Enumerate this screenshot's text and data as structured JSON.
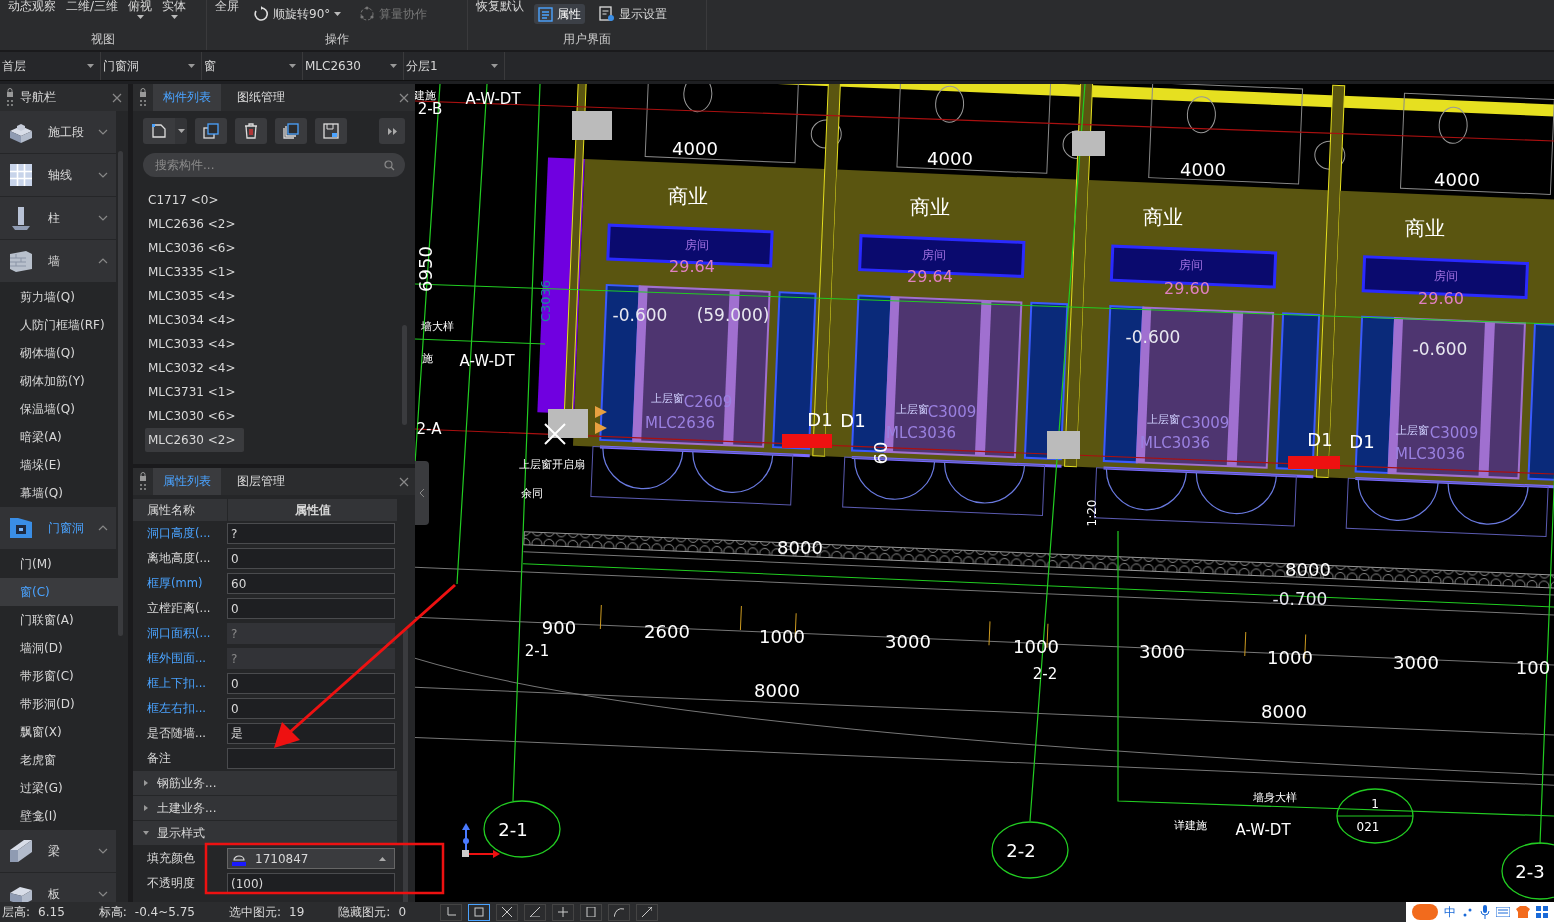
{
  "ribbon": {
    "groups": [
      {
        "label": "视图",
        "buttons": [
          {
            "label": "动态观察",
            "kind": "text",
            "dropdown": false,
            "selected": false,
            "disabled": false
          },
          {
            "label": "二维/三维",
            "kind": "text",
            "dropdown": false,
            "selected": false,
            "disabled": false
          },
          {
            "label": "俯视",
            "kind": "text",
            "dropdown": true,
            "selected": false,
            "disabled": false
          },
          {
            "label": "实体",
            "kind": "text",
            "dropdown": true,
            "selected": false,
            "disabled": false
          }
        ]
      },
      {
        "label": "操作",
        "buttons": [
          {
            "label": "全屏",
            "kind": "text",
            "dropdown": false,
            "selected": false,
            "disabled": false
          },
          {
            "label": "顺旋转90°",
            "kind": "rotate",
            "dropdown": true,
            "selected": false,
            "disabled": false
          },
          {
            "label": "算量协作",
            "kind": "collab",
            "dropdown": false,
            "selected": false,
            "disabled": true
          }
        ]
      },
      {
        "label": "用户界面",
        "buttons": [
          {
            "label": "恢复默认",
            "kind": "text",
            "dropdown": false,
            "selected": false,
            "disabled": false
          },
          {
            "label": "属性",
            "kind": "panel",
            "dropdown": false,
            "selected": true,
            "disabled": false
          },
          {
            "label": "显示设置",
            "kind": "settings",
            "dropdown": false,
            "selected": false,
            "disabled": false
          }
        ]
      }
    ]
  },
  "selectors": [
    "首层",
    "门窗洞",
    "窗",
    "MLC2630",
    "分层1"
  ],
  "nav": {
    "title": "导航栏",
    "groups": [
      {
        "label": "施工段",
        "expanded": false,
        "active": false
      },
      {
        "label": "轴线",
        "expanded": false,
        "active": false
      },
      {
        "label": "柱",
        "expanded": false,
        "active": false
      },
      {
        "label": "墙",
        "expanded": true,
        "active": false,
        "children": [
          {
            "label": "剪力墙(Q)",
            "selected": false
          },
          {
            "label": "人防门框墙(RF)",
            "selected": false
          },
          {
            "label": "砌体墙(Q)",
            "selected": false
          },
          {
            "label": "砌体加筋(Y)",
            "selected": false
          },
          {
            "label": "保温墙(Q)",
            "selected": false
          },
          {
            "label": "暗梁(A)",
            "selected": false
          },
          {
            "label": "墙垛(E)",
            "selected": false
          },
          {
            "label": "幕墙(Q)",
            "selected": false
          }
        ]
      },
      {
        "label": "门窗洞",
        "expanded": true,
        "active": true,
        "children": [
          {
            "label": "门(M)",
            "selected": false
          },
          {
            "label": "窗(C)",
            "selected": true
          },
          {
            "label": "门联窗(A)",
            "selected": false
          },
          {
            "label": "墙洞(D)",
            "selected": false
          },
          {
            "label": "带形窗(C)",
            "selected": false
          },
          {
            "label": "带形洞(D)",
            "selected": false
          },
          {
            "label": "飘窗(X)",
            "selected": false
          },
          {
            "label": "老虎窗",
            "selected": false
          },
          {
            "label": "过梁(G)",
            "selected": false
          },
          {
            "label": "壁龛(I)",
            "selected": false
          }
        ]
      },
      {
        "label": "梁",
        "expanded": false,
        "active": false
      },
      {
        "label": "板",
        "expanded": false,
        "active": false
      }
    ]
  },
  "components": {
    "tabs": [
      {
        "label": "构件列表",
        "selected": true
      },
      {
        "label": "图纸管理",
        "selected": false
      }
    ],
    "search": {
      "placeholder": "搜索构件..."
    },
    "items": [
      {
        "label": "C1717 <0>",
        "selected": false
      },
      {
        "label": "MLC2636 <2>",
        "selected": false
      },
      {
        "label": "MLC3036 <6>",
        "selected": false
      },
      {
        "label": "MLC3335 <1>",
        "selected": false
      },
      {
        "label": "MLC3035 <4>",
        "selected": false
      },
      {
        "label": "MLC3034 <4>",
        "selected": false
      },
      {
        "label": "MLC3033 <4>",
        "selected": false
      },
      {
        "label": "MLC3032 <4>",
        "selected": false
      },
      {
        "label": "MLC3731 <1>",
        "selected": false
      },
      {
        "label": "MLC3030 <6>",
        "selected": false
      },
      {
        "label": "MLC2630 <2>",
        "selected": true
      }
    ]
  },
  "properties": {
    "tabs": [
      {
        "label": "属性列表",
        "selected": true
      },
      {
        "label": "图层管理",
        "selected": false
      }
    ],
    "columns": [
      "属性名称",
      "属性值"
    ],
    "rows": [
      {
        "name": "洞口高度(...",
        "value": "?",
        "public": true,
        "readonly": false
      },
      {
        "name": "离地高度(...",
        "value": "0",
        "public": false,
        "readonly": false
      },
      {
        "name": "框厚(mm)",
        "value": "60",
        "public": true,
        "readonly": false
      },
      {
        "name": "立樘距离(...",
        "value": "0",
        "public": false,
        "readonly": false
      },
      {
        "name": "洞口面积(...",
        "value": "?",
        "public": true,
        "readonly": true
      },
      {
        "name": "框外围面...",
        "value": "?",
        "public": true,
        "readonly": true
      },
      {
        "name": "框上下扣...",
        "value": "0",
        "public": true,
        "readonly": false
      },
      {
        "name": "框左右扣...",
        "value": "0",
        "public": true,
        "readonly": false
      },
      {
        "name": "是否随墙...",
        "value": "是",
        "public": false,
        "readonly": false
      },
      {
        "name": "备注",
        "value": "",
        "public": false,
        "readonly": false
      }
    ],
    "sections": [
      {
        "label": "钢筋业务...",
        "expanded": false
      },
      {
        "label": "土建业务...",
        "expanded": false
      },
      {
        "label": "显示样式",
        "expanded": true,
        "rows": [
          {
            "name": "填充颜色",
            "value": "1710847",
            "kind": "color",
            "color": "#1a1aff"
          },
          {
            "name": "不透明度",
            "value": "(100)",
            "kind": "text"
          }
        ]
      }
    ]
  },
  "drawing_labels": [
    {
      "text": "建施",
      "kind": "note"
    },
    {
      "text": "2-B",
      "kind": "axis"
    },
    {
      "text": "A-W-DT",
      "kind": "code"
    },
    {
      "text": "4000",
      "kind": "dim"
    },
    {
      "text": "4000",
      "kind": "dim"
    },
    {
      "text": "4000",
      "kind": "dim"
    },
    {
      "text": "4000",
      "kind": "dim"
    },
    {
      "text": "商业",
      "kind": "room"
    },
    {
      "text": "商业",
      "kind": "room"
    },
    {
      "text": "商业",
      "kind": "room"
    },
    {
      "text": "商业",
      "kind": "room"
    },
    {
      "text": "房间",
      "kind": "tag"
    },
    {
      "text": "29.64",
      "kind": "area"
    },
    {
      "text": "房间",
      "kind": "tag"
    },
    {
      "text": "29.64",
      "kind": "area"
    },
    {
      "text": "房间",
      "kind": "tag"
    },
    {
      "text": "29.60",
      "kind": "area"
    },
    {
      "text": "房间",
      "kind": "tag"
    },
    {
      "text": "29.60",
      "kind": "area"
    },
    {
      "text": "6950",
      "kind": "dim"
    },
    {
      "text": "C3036",
      "kind": "cyan"
    },
    {
      "text": "墙大样",
      "kind": "note"
    },
    {
      "text": "施",
      "kind": "note"
    },
    {
      "text": "A-W-DT",
      "kind": "code"
    },
    {
      "text": "-0.600",
      "kind": "level"
    },
    {
      "text": "(59.000)",
      "kind": "level"
    },
    {
      "text": "-0.600",
      "kind": "level"
    },
    {
      "text": "-0.600",
      "kind": "level"
    },
    {
      "text": "2-A",
      "kind": "axis"
    },
    {
      "text": "上层窗",
      "kind": "wtag"
    },
    {
      "text": "C2609",
      "kind": "window"
    },
    {
      "text": "MLC2636",
      "kind": "window"
    },
    {
      "text": "D1",
      "kind": "door"
    },
    {
      "text": "D1",
      "kind": "door"
    },
    {
      "text": "上层窗",
      "kind": "wtag"
    },
    {
      "text": "C3009",
      "kind": "window"
    },
    {
      "text": "MLC3036",
      "kind": "window"
    },
    {
      "text": "上层窗",
      "kind": "wtag"
    },
    {
      "text": "C3009",
      "kind": "window"
    },
    {
      "text": "MLC3036",
      "kind": "window"
    },
    {
      "text": "D1",
      "kind": "door"
    },
    {
      "text": "D1",
      "kind": "door"
    },
    {
      "text": "上层窗",
      "kind": "wtag"
    },
    {
      "text": "C3009",
      "kind": "window"
    },
    {
      "text": "MLC3036",
      "kind": "window"
    },
    {
      "text": "60",
      "kind": "dim"
    },
    {
      "text": "上层窗开启扇",
      "kind": "note"
    },
    {
      "text": "余同",
      "kind": "note"
    },
    {
      "text": "1:20",
      "kind": "small"
    },
    {
      "text": "8000",
      "kind": "dim"
    },
    {
      "text": "8000",
      "kind": "dim"
    },
    {
      "text": "-0.700",
      "kind": "level"
    },
    {
      "text": "900",
      "kind": "dim"
    },
    {
      "text": "2600",
      "kind": "dim"
    },
    {
      "text": "1000",
      "kind": "dim"
    },
    {
      "text": "3000",
      "kind": "dim"
    },
    {
      "text": "1000",
      "kind": "dim"
    },
    {
      "text": "3000",
      "kind": "dim"
    },
    {
      "text": "1000",
      "kind": "dim"
    },
    {
      "text": "3000",
      "kind": "dim"
    },
    {
      "text": "100",
      "kind": "dim"
    },
    {
      "text": "2-1",
      "kind": "axis"
    },
    {
      "text": "2-2",
      "kind": "axis"
    },
    {
      "text": "8000",
      "kind": "dim"
    },
    {
      "text": "8000",
      "kind": "dim"
    },
    {
      "text": "墙身大样",
      "kind": "note"
    },
    {
      "text": "1",
      "kind": "small"
    },
    {
      "text": "2-1",
      "kind": "bubble"
    },
    {
      "text": "详建施",
      "kind": "note"
    },
    {
      "text": "A-W-DT",
      "kind": "code"
    },
    {
      "text": "021",
      "kind": "small"
    },
    {
      "text": "2-2",
      "kind": "bubble"
    },
    {
      "text": "2-3",
      "kind": "bubble"
    }
  ],
  "status_bar": [
    {
      "label": "层高:",
      "value": "6.15"
    },
    {
      "label": "标高:",
      "value": "-0.4~5.75"
    },
    {
      "label": "选中图元:",
      "value": "19"
    },
    {
      "label": "隐藏图元:",
      "value": "0"
    }
  ],
  "tray": {
    "ime": "中"
  }
}
